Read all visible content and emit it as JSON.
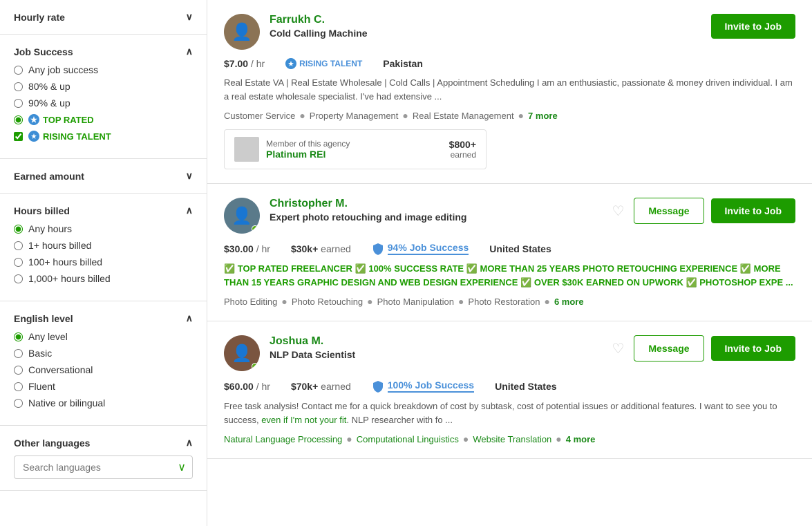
{
  "sidebar": {
    "sections": [
      {
        "id": "hourly-rate",
        "label": "Hourly rate",
        "expanded": false,
        "chevron": "∨"
      },
      {
        "id": "job-success",
        "label": "Job Success",
        "expanded": true,
        "chevron": "∧",
        "options": [
          {
            "type": "radio",
            "label": "Any job success",
            "checked": false
          },
          {
            "type": "radio",
            "label": "80% & up",
            "checked": false
          },
          {
            "type": "radio",
            "label": "90% & up",
            "checked": false
          },
          {
            "type": "radio",
            "label": "TOP RATED",
            "checked": true,
            "badge": true,
            "badgeType": "top-rated"
          },
          {
            "type": "checkbox",
            "label": "RISING TALENT",
            "checked": true,
            "badge": true,
            "badgeType": "rising-talent"
          }
        ]
      },
      {
        "id": "earned-amount",
        "label": "Earned amount",
        "expanded": false,
        "chevron": "∨"
      },
      {
        "id": "hours-billed",
        "label": "Hours billed",
        "expanded": true,
        "chevron": "∧",
        "options": [
          {
            "type": "radio",
            "label": "Any hours",
            "checked": true
          },
          {
            "type": "radio",
            "label": "1+ hours billed",
            "checked": false
          },
          {
            "type": "radio",
            "label": "100+ hours billed",
            "checked": false
          },
          {
            "type": "radio",
            "label": "1,000+ hours billed",
            "checked": false
          }
        ]
      },
      {
        "id": "english-level",
        "label": "English level",
        "expanded": true,
        "chevron": "∧",
        "options": [
          {
            "type": "radio",
            "label": "Any level",
            "checked": true
          },
          {
            "type": "radio",
            "label": "Basic",
            "checked": false
          },
          {
            "type": "radio",
            "label": "Conversational",
            "checked": false
          },
          {
            "type": "radio",
            "label": "Fluent",
            "checked": false
          },
          {
            "type": "radio",
            "label": "Native or bilingual",
            "checked": false
          }
        ]
      },
      {
        "id": "other-languages",
        "label": "Other languages",
        "expanded": true,
        "chevron": "∧",
        "search_placeholder": "Search languages"
      }
    ]
  },
  "freelancers": [
    {
      "id": 1,
      "name": "Farrukh C.",
      "title": "Cold Calling Machine",
      "rate": "$7.00",
      "earned": null,
      "badge": "RISING TALENT",
      "country": "Pakistan",
      "description": "Real Estate VA | Real Estate Wholesale | Cold Calls | Appointment Scheduling I am an enthusiastic, passionate & money driven individual. I am a real estate wholesale specialist. I've had extensive ...",
      "skills": [
        "Customer Service",
        "Property Management",
        "Real Estate Management"
      ],
      "more_skills": "7 more",
      "job_success": null,
      "has_agency": true,
      "agency_label": "Member of this agency",
      "agency_name": "Platinum REI",
      "agency_earned": "$800+",
      "agency_earned_label": "earned",
      "show_message": false,
      "invite_label": "Invite to Job",
      "online": false
    },
    {
      "id": 2,
      "name": "Christopher M.",
      "title": "Expert photo retouching and image editing",
      "rate": "$30.00",
      "earned": "$30k+",
      "earned_label": "earned",
      "badge": null,
      "job_success": "94%",
      "job_success_label": "Job Success",
      "country": "United States",
      "description": "✅ TOP RATED FREELANCER ✅ 100% SUCCESS RATE ✅ MORE THAN 25 YEARS PHOTO RETOUCHING EXPERIENCE ✅ MORE THAN 15 YEARS GRAPHIC DESIGN AND WEB DESIGN EXPERIENCE ✅ OVER $30K EARNED ON UPWORK ✅ PHOTOSHOP EXPE ...",
      "skills": [
        "Photo Editing",
        "Photo Retouching",
        "Photo Manipulation",
        "Photo Restoration"
      ],
      "more_skills": "6 more",
      "has_agency": false,
      "show_message": true,
      "invite_label": "Invite to Job",
      "message_label": "Message",
      "online": true
    },
    {
      "id": 3,
      "name": "Joshua M.",
      "title": "NLP Data Scientist",
      "rate": "$60.00",
      "earned": "$70k+",
      "earned_label": "earned",
      "badge": null,
      "job_success": "100%",
      "job_success_label": "Job Success",
      "country": "United States",
      "description": "Free task analysis! Contact me for a quick breakdown of cost by subtask, cost of potential issues or additional features. I want to see you to success, even if I'm not your fit. NLP researcher with fo ...",
      "skills": [
        "Natural Language Processing",
        "Computational Linguistics",
        "Website Translation"
      ],
      "more_skills": "4 more",
      "has_agency": false,
      "show_message": true,
      "invite_label": "Invite to Job",
      "message_label": "Message",
      "online": true
    }
  ],
  "colors": {
    "green": "#1d9c00",
    "green_text": "#1a8917",
    "blue": "#4a90d9",
    "border": "#e0e0e0"
  }
}
